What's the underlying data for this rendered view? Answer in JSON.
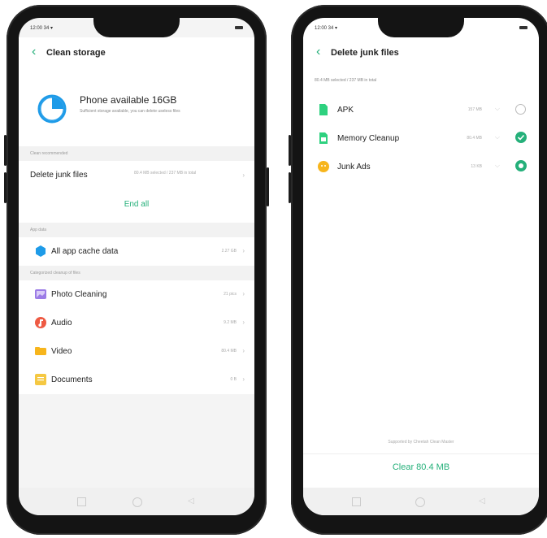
{
  "left_screen": {
    "status": {
      "time": "12:00 34 ▾"
    },
    "title": "Clean storage",
    "storage": {
      "heading": "Phone available 16GB",
      "description": "Sufficient storage available, you can delete useless files"
    },
    "clean_recommended": {
      "header": "Clean recommended",
      "row_label": "Delete junk files",
      "row_value": "80.4 MB selected / 237 MB in total",
      "end_all": "End all"
    },
    "app_data": {
      "header": "App data",
      "item": {
        "label": "All app cache data",
        "value": "2.27 GB",
        "icon": "hexagon-icon",
        "color": "#1e9be8"
      }
    },
    "categorized": {
      "header": "Categorized cleanup of files",
      "items": [
        {
          "label": "Photo Cleaning",
          "value": "21 pics",
          "icon": "photo-icon",
          "color": "#9c7ce6"
        },
        {
          "label": "Audio",
          "value": "9.2 MB",
          "icon": "audio-icon",
          "color": "#ee5a43"
        },
        {
          "label": "Video",
          "value": "80.4 MB",
          "icon": "video-icon",
          "color": "#f7b51c"
        },
        {
          "label": "Documents",
          "value": "0 B",
          "icon": "document-icon",
          "color": "#f5c842"
        }
      ]
    }
  },
  "right_screen": {
    "status": {
      "time": "12:00 34 ▾"
    },
    "title": "Delete junk files",
    "summary": "80.4 MB selected / 237 MB in total",
    "items": [
      {
        "label": "APK",
        "value": "157 MB",
        "icon": "apk-icon",
        "color": "#2ed17f",
        "checked": false
      },
      {
        "label": "Memory Cleanup",
        "value": "80.4 MB",
        "icon": "memory-icon",
        "color": "#2ed17f",
        "checked": true
      },
      {
        "label": "Junk Ads",
        "value": "13 KB",
        "icon": "ads-icon",
        "color": "#f7b51c",
        "checked": true
      }
    ],
    "footer_note": "Supported by Cheetah Clean Master",
    "clear_button": "Clear 80.4 MB"
  },
  "accent_color": "#25b07a"
}
